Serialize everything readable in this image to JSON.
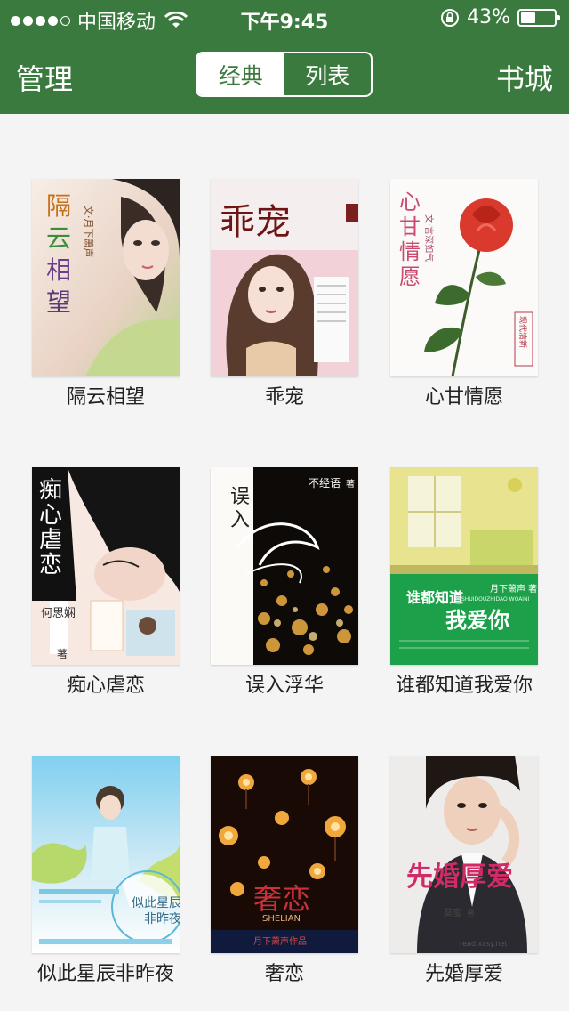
{
  "status_bar": {
    "carrier": "中国移动",
    "time": "下午9:45",
    "battery": "43%",
    "signal_filled": 4,
    "signal_total": 5
  },
  "nav": {
    "left": "管理",
    "right": "书城",
    "tabs": [
      {
        "label": "经典",
        "active": true
      },
      {
        "label": "列表",
        "active": false
      }
    ]
  },
  "books": [
    {
      "title": "隔云相望",
      "cover_text": [
        "隔",
        "云",
        "相",
        "望"
      ],
      "author": "文·月下萧声"
    },
    {
      "title": "乖宠",
      "cover_text": [
        "乖宠"
      ]
    },
    {
      "title": "心甘情愿",
      "cover_text": [
        "心",
        "甘",
        "情",
        "愿"
      ],
      "author": "文·言深如气",
      "tag": "现代清新"
    },
    {
      "title": "痴心虐恋",
      "cover_text": [
        "痴",
        "心",
        "虐",
        "恋"
      ],
      "author": "何思娴",
      "author_suffix": "著"
    },
    {
      "title": "误入浮华",
      "cover_text": [
        "误",
        "入"
      ],
      "author": "不经语",
      "author_suffix": "著"
    },
    {
      "title": "谁都知道我爱你",
      "cover_text": [
        "谁都知道",
        "我爱你"
      ],
      "author": "月下萧声 著",
      "pinyin": "SHUIDOUZHIDAO WOAINI"
    },
    {
      "title": "似此星辰非昨夜",
      "cover_text": [
        "似此星辰",
        "非昨夜"
      ]
    },
    {
      "title": "奢恋",
      "cover_text": [
        "奢恋"
      ],
      "pinyin": "SHELIAN",
      "author": "月下萧声作品"
    },
    {
      "title": "先婚厚爱",
      "cover_text": [
        "先婚厚爱"
      ],
      "author": "莫蜜",
      "author_suffix": "著",
      "site": "read.xxsy.net"
    }
  ]
}
